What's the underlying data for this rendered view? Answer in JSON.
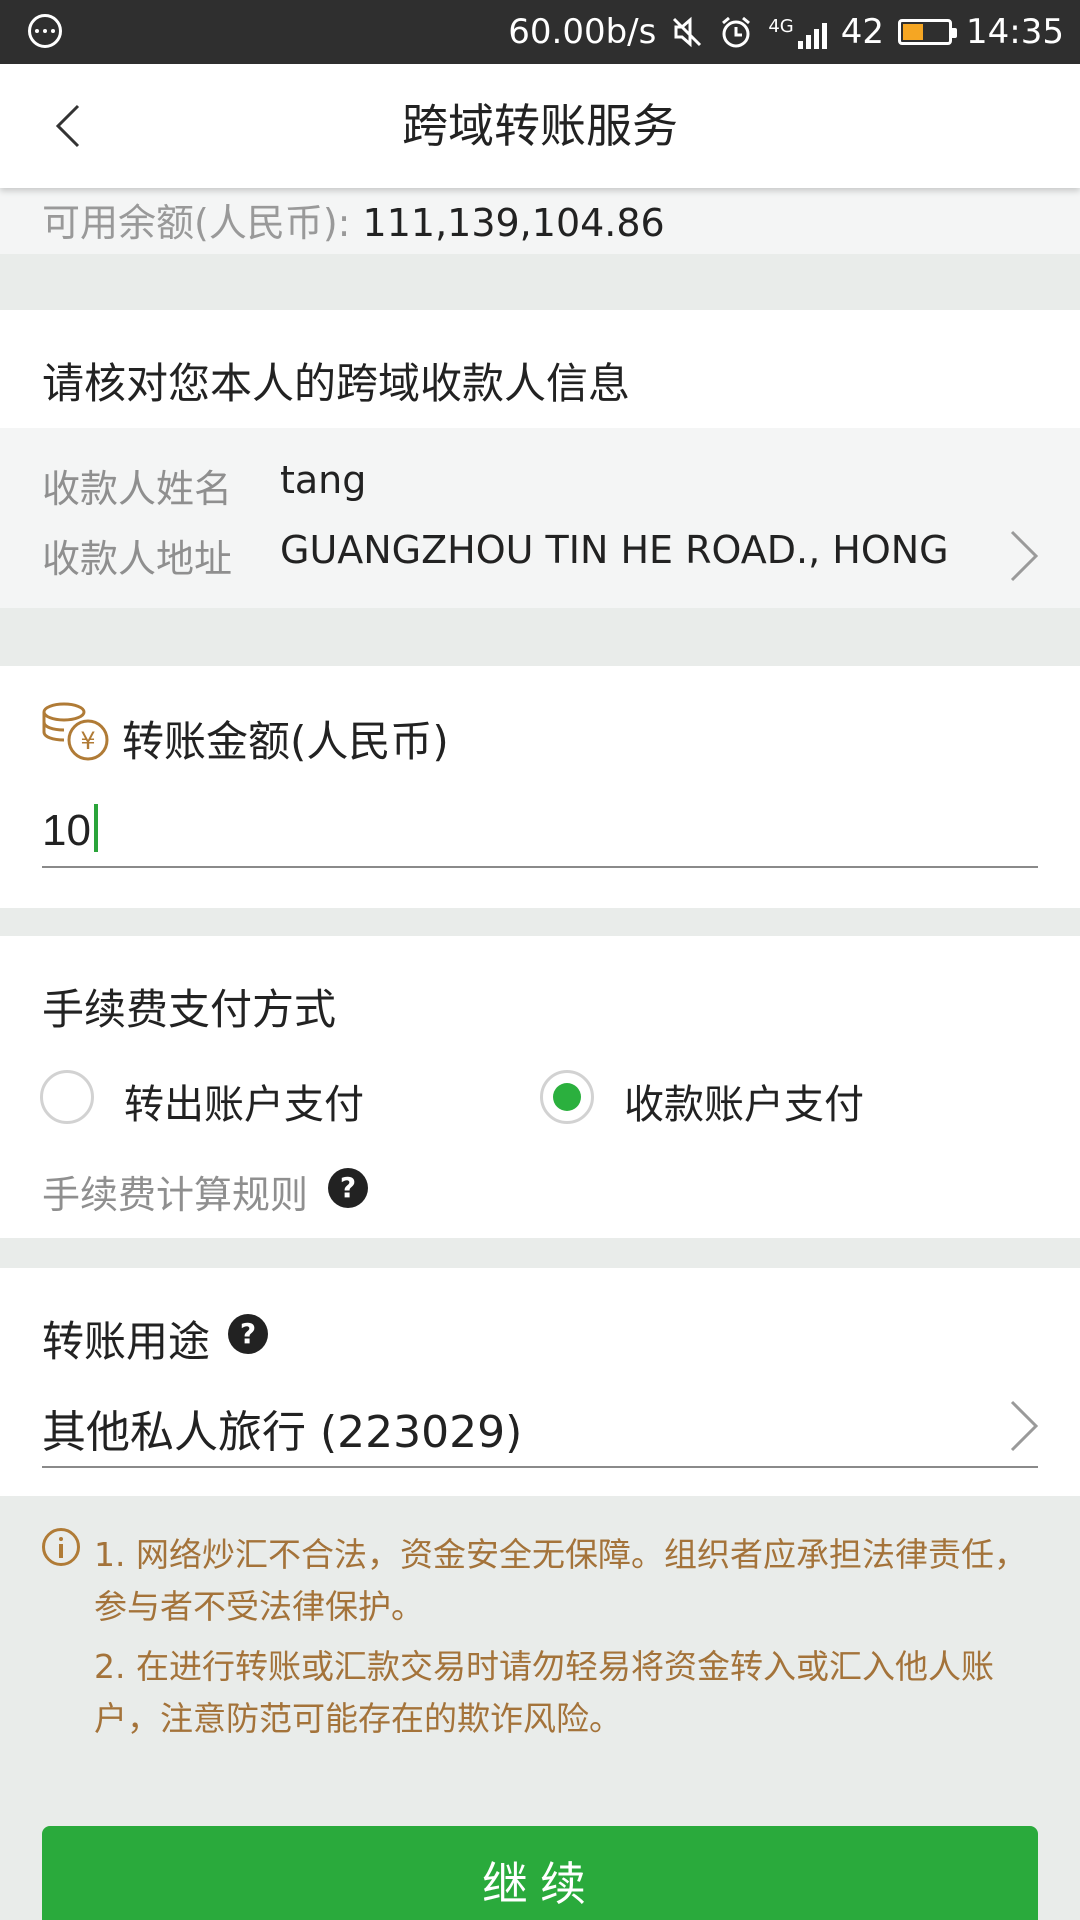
{
  "status_bar": {
    "speed": "60.00b/s",
    "network": "4G",
    "battery_level": "42",
    "time": "14:35",
    "icons": [
      "more-dots-icon",
      "mute-icon",
      "alarm-icon",
      "signal-icon",
      "battery-icon"
    ]
  },
  "header": {
    "title": "跨域转账服务",
    "back_icon": "back-chevron-icon"
  },
  "balance": {
    "label": "可用余额(人民币): ",
    "value": "111,139,104.86"
  },
  "payee": {
    "section_title": "请核对您本人的跨域收款人信息",
    "name_label": "收款人姓名",
    "name_value": "tang",
    "address_label": "收款人地址",
    "address_value": "GUANGZHOU TIN HE ROAD., HONG"
  },
  "amount": {
    "label": "转账金额(人民币)",
    "value": "10",
    "icon": "coin-yuan-icon"
  },
  "fee": {
    "section_title": "手续费支付方式",
    "option_1": "转出账户支付",
    "option_2": "收款账户支付",
    "selected": "收款账户支付",
    "rules_label": "手续费计算规则",
    "help_glyph": "?"
  },
  "purpose": {
    "label": "转账用途",
    "value": "其他私人旅行 (223029)",
    "help_glyph": "?"
  },
  "notice": {
    "line1": "1. 网络炒汇不合法，资金安全无保障。组织者应承担法律责任，",
    "line2": "参与者不受法律保护。",
    "line3": "2. 在进行转账或汇款交易时请勿轻易将资金转入或汇入他人账",
    "line4": "户，注意防范可能存在的欺诈风险。"
  },
  "continue_button": {
    "label": "继续"
  },
  "colors": {
    "accent_green": "#2aaa3c",
    "notice_text": "#a4733a",
    "status_bar_bg": "#2f2f2f",
    "page_bg": "#e9ecea"
  }
}
